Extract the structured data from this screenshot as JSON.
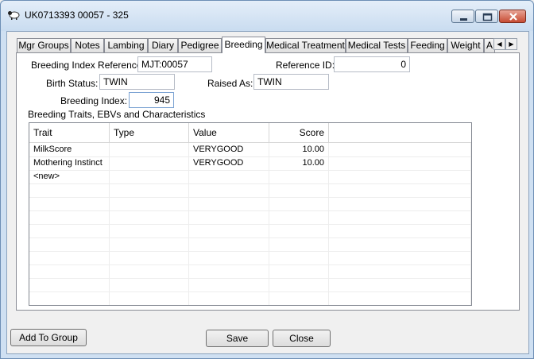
{
  "window": {
    "title": "UK0713393 00057 - 325"
  },
  "tabs": [
    {
      "label": "Mgr Groups"
    },
    {
      "label": "Notes"
    },
    {
      "label": "Lambing"
    },
    {
      "label": "Diary"
    },
    {
      "label": "Pedigree"
    },
    {
      "label": "Breeding"
    },
    {
      "label": "Medical Treatment"
    },
    {
      "label": "Medical Tests"
    },
    {
      "label": "Feeding"
    },
    {
      "label": "Weight"
    },
    {
      "label": "A"
    }
  ],
  "active_tab": "Breeding",
  "form": {
    "breeding_index_reference_label": "Breeding Index Reference:",
    "breeding_index_reference_value": "MJT:00057",
    "reference_id_label": "Reference ID:",
    "reference_id_value": "0",
    "birth_status_label": "Birth Status:",
    "birth_status_value": "TWIN",
    "raised_as_label": "Raised As:",
    "raised_as_value": "TWIN",
    "breeding_index_label": "Breeding Index:",
    "breeding_index_value": "945"
  },
  "traits": {
    "section_label": "Breeding Traits, EBVs and Characteristics",
    "columns": [
      "Trait",
      "Type",
      "Value",
      "Score"
    ],
    "rows": [
      [
        "MilkScore",
        "",
        "VERYGOOD",
        "10.00"
      ],
      [
        "Mothering Instinct",
        "",
        "VERYGOOD",
        "10.00"
      ],
      [
        "<new>",
        "",
        "",
        ""
      ]
    ]
  },
  "buttons": {
    "add_to_group": "Add To Group",
    "save": "Save",
    "close": "Close"
  },
  "colors": {
    "titlebar": "#c9dcf0",
    "close_button": "#c74b33",
    "panel": "#ffffff"
  }
}
